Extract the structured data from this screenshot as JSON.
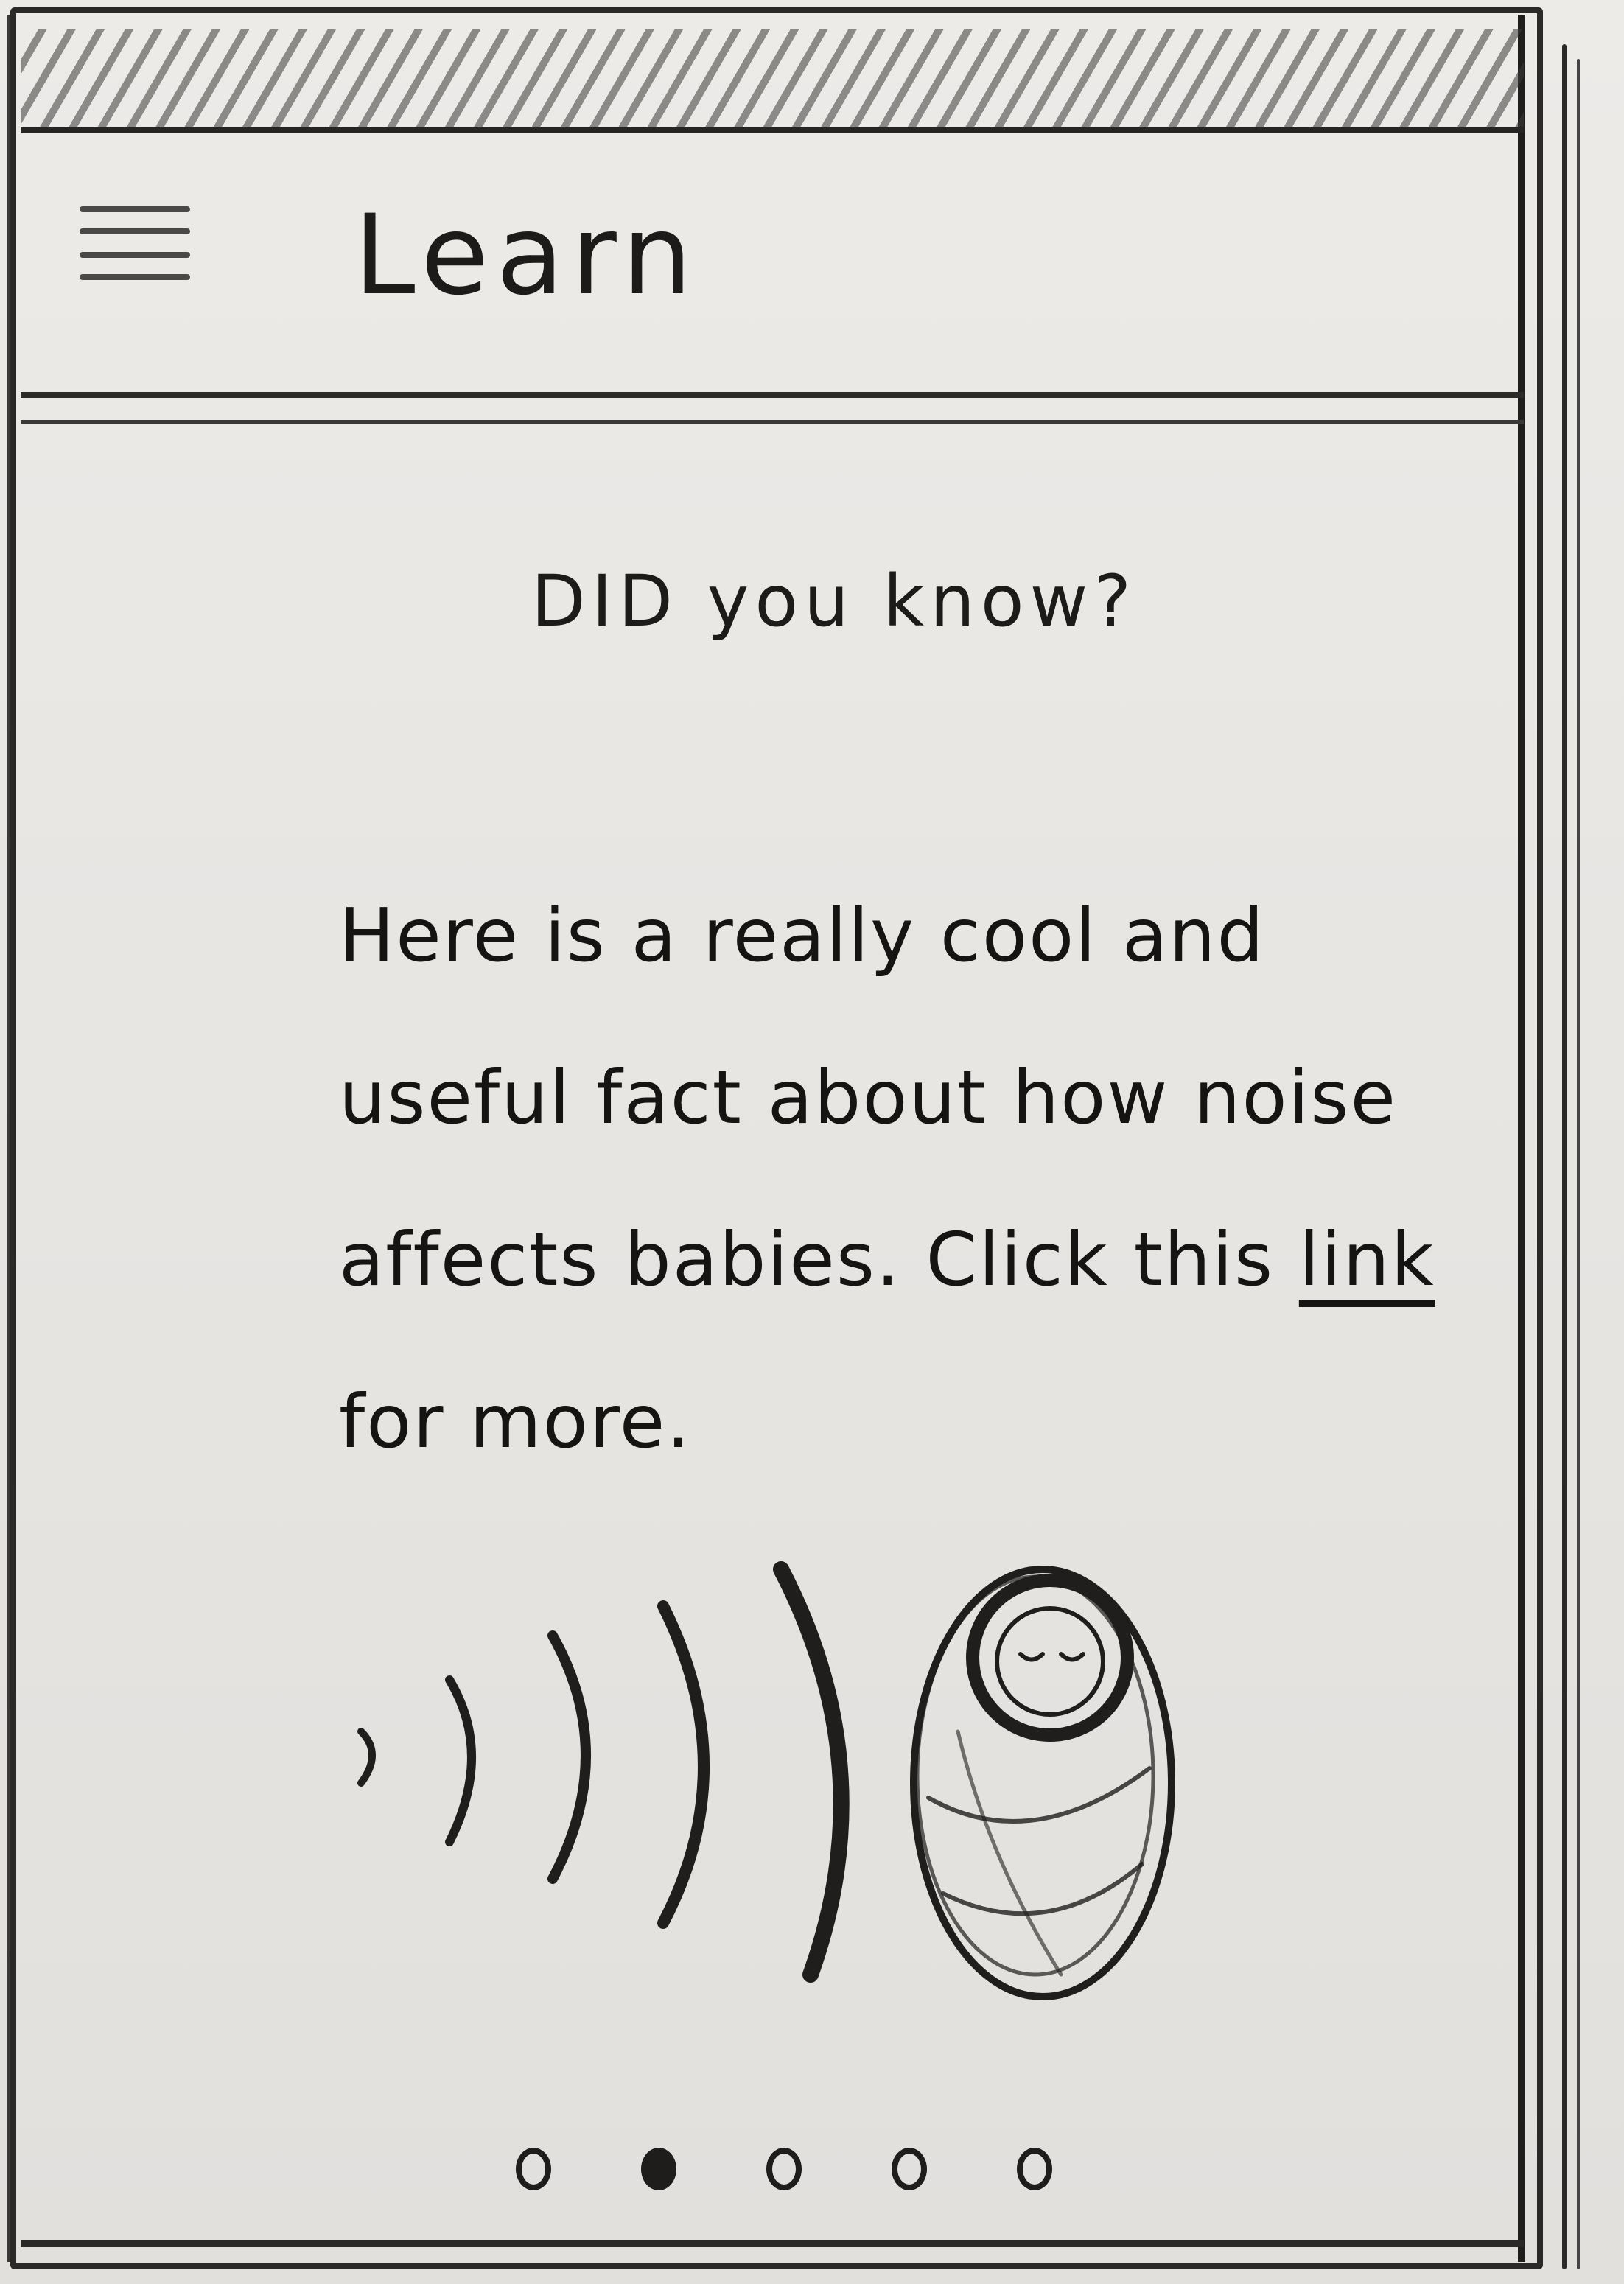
{
  "app_bar": {
    "title": "Learn",
    "menu_icon": "hamburger-menu-icon"
  },
  "content": {
    "heading": "DID you know?",
    "fact_text_before": "Here is a really cool and useful fact about how noise affects babies. Click this ",
    "link_text": "link",
    "fact_text_after": " for more."
  },
  "illustration": {
    "icon": "sound-waves-baby-icon"
  },
  "pager": {
    "total": 5,
    "active_index": 1
  }
}
